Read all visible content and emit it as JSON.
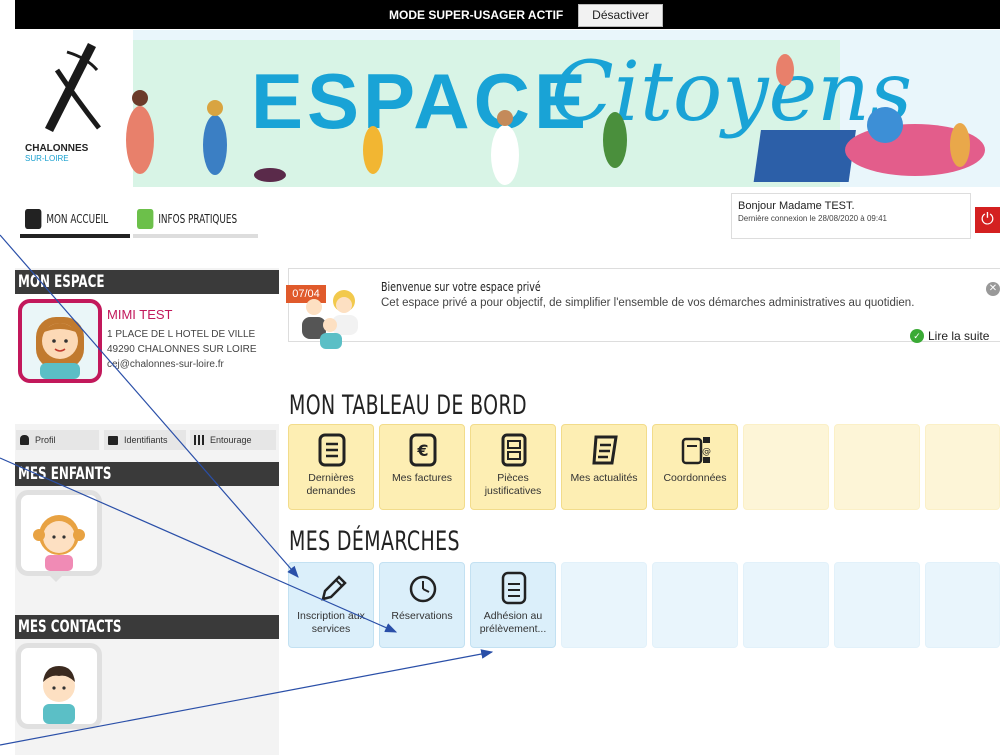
{
  "superbar": {
    "text": "MODE SUPER-USAGER ACTIF",
    "button": "Désactiver"
  },
  "banner": {
    "logo_main": "CHALONNES",
    "logo_sub": "SUR-LOIRE",
    "title_1": "ESPACE",
    "title_2": "Citoyens"
  },
  "nav": {
    "home": "MON ACCUEIL",
    "info": "INFOS PRATIQUES"
  },
  "user": {
    "greeting": "Bonjour Madame TEST.",
    "last_login": "Dernière connexion le 28/08/2020 à 09:41"
  },
  "sidebar": {
    "espace_title": "MON ESPACE",
    "name": "MIMI TEST",
    "address1": "1 PLACE DE L HOTEL DE VILLE",
    "address2": "49290 CHALONNES SUR LOIRE",
    "email": "cej@chalonnes-sur-loire.fr",
    "tabs": [
      "Profil",
      "Identifiants",
      "Entourage"
    ],
    "children_title": "MES ENFANTS",
    "contacts_title": "MES CONTACTS"
  },
  "welcome": {
    "date": "07/04",
    "title": "Bienvenue sur votre espace privé",
    "desc": "Cet espace privé a pour objectif, de simplifier l'ensemble de vos démarches administratives au quotidien.",
    "read_more": "Lire la suite",
    "close_icon": "close-icon"
  },
  "dashboard": {
    "title": "MON TABLEAU DE BORD",
    "tiles": [
      "Dernières demandes",
      "Mes factures",
      "Pièces justificatives",
      "Mes actualités",
      "Coordonnées"
    ]
  },
  "demarches": {
    "title": "MES DÉMARCHES",
    "tiles": [
      "Inscription aux services",
      "Réservations",
      "Adhésion au prélèvement..."
    ]
  },
  "colors": {
    "accent_blue": "#19a3d6",
    "magenta": "#c2185b",
    "dark": "#3a3a3a",
    "logout_red": "#d42020",
    "arrow_blue": "#2a4fa8"
  }
}
